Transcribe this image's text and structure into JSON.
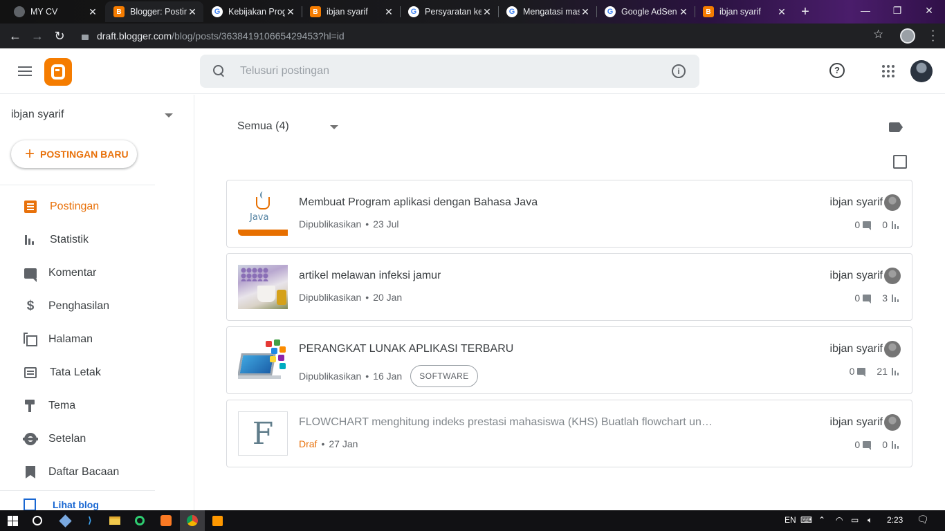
{
  "browser": {
    "tabs": [
      {
        "title": "MY CV",
        "favicon": "cv-icon"
      },
      {
        "title": "Blogger: Postin",
        "favicon": "blogger-icon",
        "active": true
      },
      {
        "title": "Kebijakan Prog",
        "favicon": "google-icon"
      },
      {
        "title": "ibjan syarif",
        "favicon": "blogger-icon"
      },
      {
        "title": "Persyaratan ke",
        "favicon": "google-icon"
      },
      {
        "title": "Mengatasi mas",
        "favicon": "google-icon"
      },
      {
        "title": "Google AdSen",
        "favicon": "google-icon"
      },
      {
        "title": "ibjan syarif",
        "favicon": "blogger-icon"
      }
    ],
    "url_host": "draft.blogger.com",
    "url_path": "/blog/posts/363841910665429453?hl=id"
  },
  "header": {
    "search_placeholder": "Telusuri postingan",
    "help_glyph": "?",
    "info_glyph": "i"
  },
  "sidebar": {
    "blog_name": "ibjan syarif",
    "new_post_label": "POSTINGAN BARU",
    "new_post_glyph": "+",
    "items": [
      {
        "label": "Postingan",
        "icon": "posts-icon",
        "active": true
      },
      {
        "label": "Statistik",
        "icon": "stats-icon"
      },
      {
        "label": "Komentar",
        "icon": "comment-icon"
      },
      {
        "label": "Penghasilan",
        "icon": "dollar-icon"
      },
      {
        "label": "Halaman",
        "icon": "pages-icon"
      },
      {
        "label": "Tata Letak",
        "icon": "layout-icon"
      },
      {
        "label": "Tema",
        "icon": "theme-icon"
      },
      {
        "label": "Setelan",
        "icon": "gear-icon"
      },
      {
        "label": "Daftar Bacaan",
        "icon": "bookmark-icon"
      }
    ],
    "view_blog_label": "Lihat blog"
  },
  "main": {
    "filter_label": "Semua (4)",
    "posts": [
      {
        "title": "Membuat Program aplikasi dengan Bahasa Java",
        "status": "Dipublikasikan",
        "date": "23 Jul",
        "label": "",
        "author": "ibjan syarif",
        "comments": "0",
        "views": "0",
        "thumb_text": "Java"
      },
      {
        "title": "artikel melawan infeksi jamur",
        "status": "Dipublikasikan",
        "date": "20 Jan",
        "label": "",
        "author": "ibjan syarif",
        "comments": "0",
        "views": "3"
      },
      {
        "title": "PERANGKAT LUNAK APLIKASI TERBARU",
        "status": "Dipublikasikan",
        "date": "16 Jan",
        "label": "SOFTWARE",
        "author": "ibjan syarif",
        "comments": "0",
        "views": "21"
      },
      {
        "title": "FLOWCHART menghitung indeks prestasi mahasiswa (KHS) Buatlah flowchart un…",
        "status": "Draf",
        "date": "27 Jan",
        "label": "",
        "author": "ibjan syarif",
        "comments": "0",
        "views": "0",
        "thumb_text": "F"
      }
    ],
    "dot_separator": "•"
  },
  "taskbar": {
    "language": "EN",
    "time": "2:23"
  },
  "colors": {
    "accent": "#e8710a",
    "blogger_orange": "#f57c00",
    "link_blue": "#1967d2"
  }
}
